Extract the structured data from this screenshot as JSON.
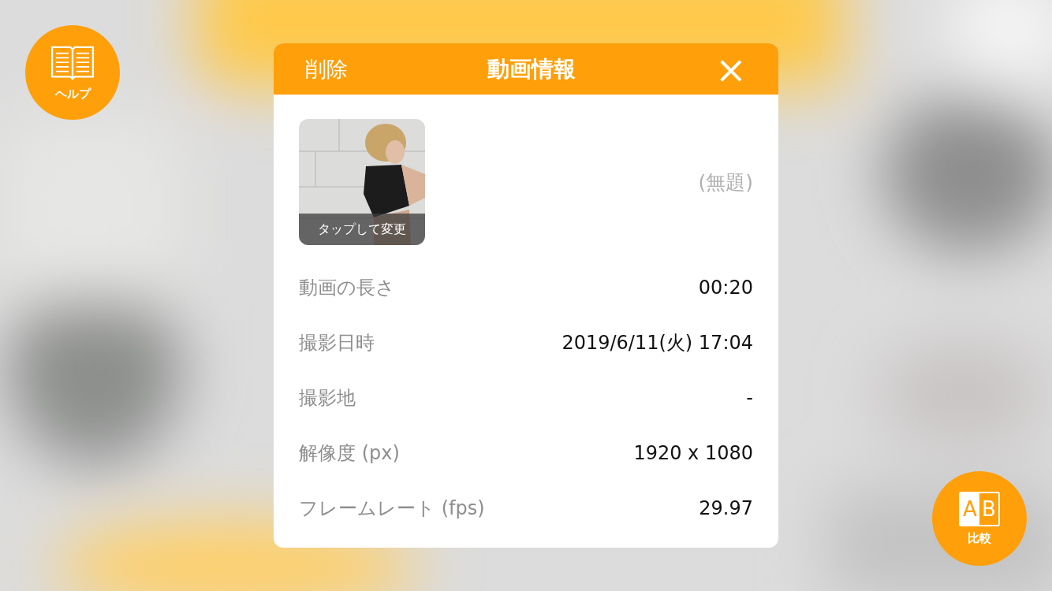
{
  "help_button": {
    "label": "ヘルプ"
  },
  "compare_button": {
    "label": "比較",
    "icon_letters": [
      "A",
      "B"
    ]
  },
  "dialog": {
    "title": "動画情報",
    "delete_label": "削除",
    "close_label": "×",
    "thumbnail": {
      "kind": "picture",
      "caption": "タップして変更"
    },
    "video_title": "(無題)",
    "rows": [
      {
        "label": "動画の長さ",
        "value": "00:20"
      },
      {
        "label": "撮影日時",
        "value": "2019/6/11(火) 17:04"
      },
      {
        "label": "撮影地",
        "value": "-"
      },
      {
        "label": "解像度 (px)",
        "value": "1920 x 1080"
      },
      {
        "label": "フレームレート (fps)",
        "value": "29.97"
      }
    ]
  }
}
